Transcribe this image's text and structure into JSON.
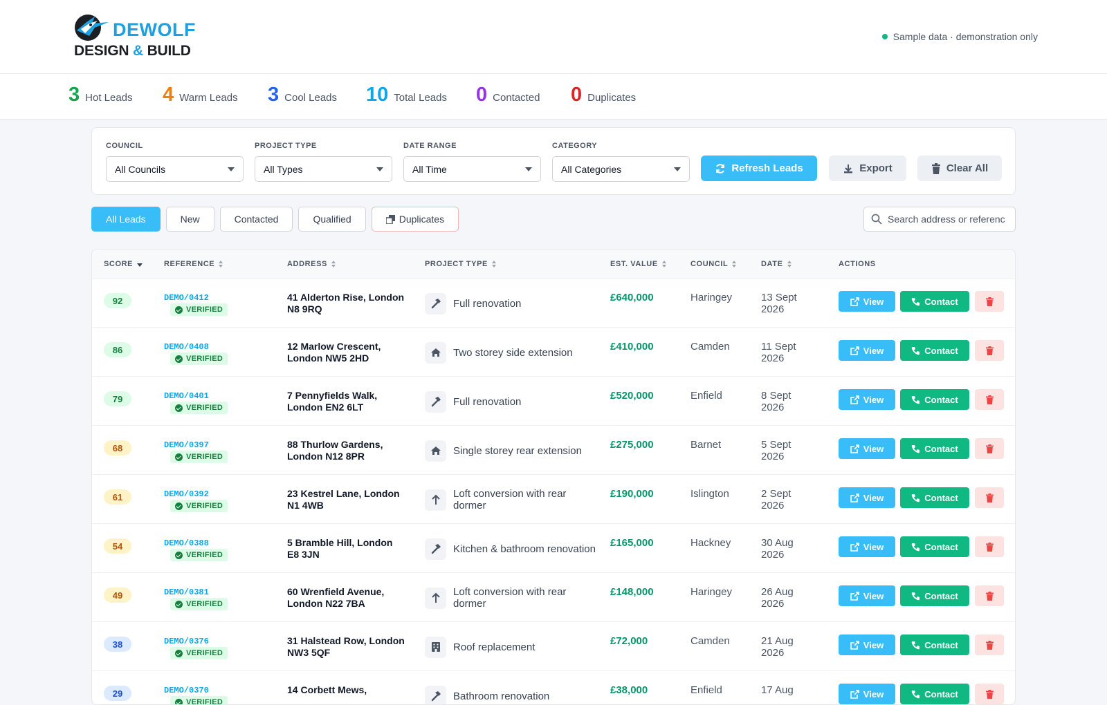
{
  "brand": {
    "name_top": "DEWOLF",
    "name_bottom_left": "DESIGN",
    "name_amp": "&",
    "name_bottom_right": "BUILD"
  },
  "demo_note": "Sample data · demonstration only",
  "stats": [
    {
      "value": "3",
      "label": "Hot Leads",
      "color": "#16a34a"
    },
    {
      "value": "4",
      "label": "Warm Leads",
      "color": "#f07f0e"
    },
    {
      "value": "3",
      "label": "Cool Leads",
      "color": "#2563eb"
    },
    {
      "value": "10",
      "label": "Total Leads",
      "color": "#0ea5e9"
    },
    {
      "value": "0",
      "label": "Contacted",
      "color": "#9333ea"
    },
    {
      "value": "0",
      "label": "Duplicates",
      "color": "#dc2626"
    }
  ],
  "filters": {
    "council": {
      "label": "COUNCIL",
      "value": "All Councils"
    },
    "project_type": {
      "label": "PROJECT TYPE",
      "value": "All Types"
    },
    "date_range": {
      "label": "DATE RANGE",
      "value": "All Time"
    },
    "category": {
      "label": "CATEGORY",
      "value": "All Categories"
    },
    "refresh_label": "Refresh Leads",
    "export_label": "Export",
    "clear_label": "Clear All"
  },
  "tabs": [
    {
      "label": "All Leads",
      "active": true
    },
    {
      "label": "New"
    },
    {
      "label": "Contacted"
    },
    {
      "label": "Qualified"
    },
    {
      "label": "Duplicates"
    }
  ],
  "search": {
    "placeholder": "Search address or reference..."
  },
  "columns": {
    "score": "SCORE",
    "reference": "REFERENCE",
    "address": "ADDRESS",
    "project_type": "PROJECT TYPE",
    "value": "EST. VALUE",
    "council": "COUNCIL",
    "date": "DATE",
    "actions": "ACTIONS"
  },
  "actions": {
    "view": "View",
    "contact": "Contact"
  },
  "verified_label": "VERIFIED",
  "rows": [
    {
      "score": "92",
      "tier": "hot",
      "ref": "DEMO/0412",
      "addr": "41 Alderton Rise, London N8 9RQ",
      "icon": "hammer-icon",
      "type": "Full renovation",
      "value": "£640,000",
      "council": "Haringey",
      "date": "13 Sept 2026"
    },
    {
      "score": "86",
      "tier": "hot",
      "ref": "DEMO/0408",
      "addr": "12 Marlow Crescent, London NW5 2HD",
      "icon": "house-icon",
      "type": "Two storey side extension",
      "value": "£410,000",
      "council": "Camden",
      "date": "11 Sept 2026"
    },
    {
      "score": "79",
      "tier": "hot",
      "ref": "DEMO/0401",
      "addr": "7 Pennyfields Walk, London EN2 6LT",
      "icon": "hammer-icon",
      "type": "Full renovation",
      "value": "£520,000",
      "council": "Enfield",
      "date": "8 Sept 2026"
    },
    {
      "score": "68",
      "tier": "warm",
      "ref": "DEMO/0397",
      "addr": "88 Thurlow Gardens, London N12 8PR",
      "icon": "house-icon",
      "type": "Single storey rear extension",
      "value": "£275,000",
      "council": "Barnet",
      "date": "5 Sept 2026"
    },
    {
      "score": "61",
      "tier": "warm",
      "ref": "DEMO/0392",
      "addr": "23 Kestrel Lane, London N1 4WB",
      "icon": "arrow-up-icon",
      "type": "Loft conversion with rear dormer",
      "value": "£190,000",
      "council": "Islington",
      "date": "2 Sept 2026"
    },
    {
      "score": "54",
      "tier": "warm",
      "ref": "DEMO/0388",
      "addr": "5 Bramble Hill, London E8 3JN",
      "icon": "hammer-icon",
      "type": "Kitchen & bathroom renovation",
      "value": "£165,000",
      "council": "Hackney",
      "date": "30 Aug 2026"
    },
    {
      "score": "49",
      "tier": "warm",
      "ref": "DEMO/0381",
      "addr": "60 Wrenfield Avenue, London N22 7BA",
      "icon": "arrow-up-icon",
      "type": "Loft conversion with rear dormer",
      "value": "£148,000",
      "council": "Haringey",
      "date": "26 Aug 2026"
    },
    {
      "score": "38",
      "tier": "cool",
      "ref": "DEMO/0376",
      "addr": "31 Halstead Row, London NW3 5QF",
      "icon": "building-icon",
      "type": "Roof replacement",
      "value": "£72,000",
      "council": "Camden",
      "date": "21 Aug 2026"
    },
    {
      "score": "29",
      "tier": "cool",
      "ref": "DEMO/0370",
      "addr": "14 Corbett Mews,",
      "icon": "hammer-icon",
      "type": "Bathroom renovation",
      "value": "£38,000",
      "council": "Enfield",
      "date": "17 Aug"
    }
  ]
}
